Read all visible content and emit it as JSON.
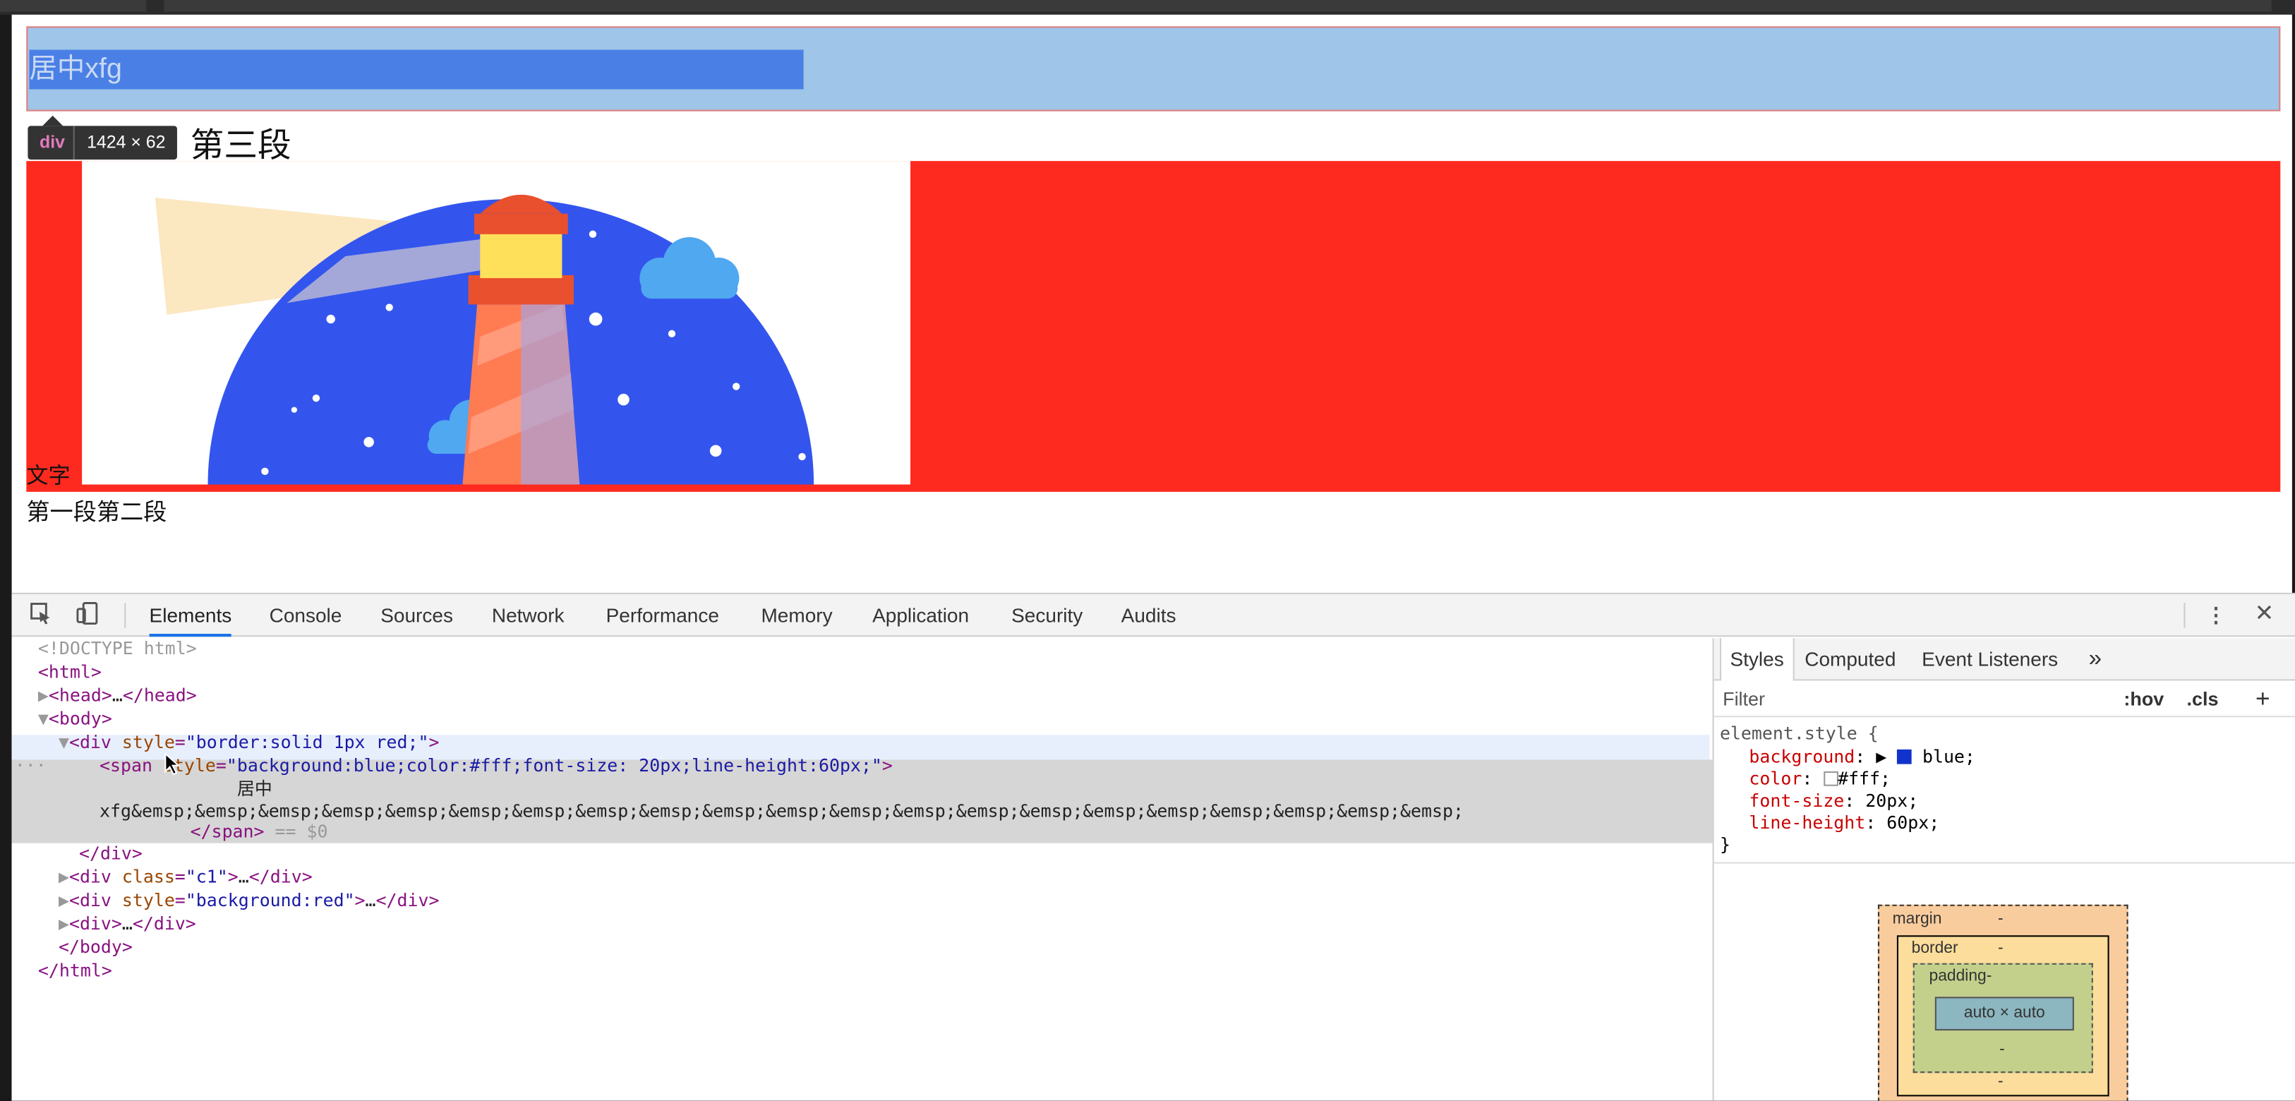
{
  "viewport": {
    "span_text": "居中xfg",
    "tooltip_tag": "div",
    "tooltip_dim": "1424 × 62",
    "para3": "第三段",
    "wenzi": "文字",
    "para12": "第一段第二段"
  },
  "colors": {
    "span_bg": "#4a80e6",
    "div_bg": "#9fc5e8",
    "red": "#ff2a1f",
    "lighthouse_sky": "#3355ee"
  },
  "devtools": {
    "tabs": [
      "Elements",
      "Console",
      "Sources",
      "Network",
      "Performance",
      "Memory",
      "Application",
      "Security",
      "Audits"
    ],
    "active_tab": "Elements",
    "more_icon": "kebab-icon",
    "close_icon": "close-icon",
    "elements": {
      "doctype": "<!DOCTYPE html>",
      "html_open": "<html>",
      "head": "…",
      "div1_attr": "style",
      "div1_val": "\"border:solid 1px red;\"",
      "span_attr": "style",
      "span_val": "\"background:blue;color:#fff;font-size: 20px;line-height:60px;\"",
      "span_text1": "居中",
      "span_text2": "xfg&emsp;&emsp;&emsp;&emsp;&emsp;&emsp;&emsp;&emsp;&emsp;&emsp;&emsp;&emsp;&emsp;&emsp;&emsp;&emsp;&emsp;&emsp;&emsp;&emsp;&emsp;",
      "span_close_suffix": " == $0",
      "div_c1_attr": "class",
      "div_c1_val": "\"c1\"",
      "div_red_attr": "style",
      "div_red_val": "\"background:red\"",
      "ellipsis": "…",
      "gutter_dots": "···"
    },
    "sidebar": {
      "tabs": [
        "Styles",
        "Computed",
        "Event Listeners"
      ],
      "more": "»",
      "filter_placeholder": "Filter",
      "hov": ":hov",
      "cls": ".cls",
      "plus": "+",
      "selector": "element.style {",
      "close_brace": "}",
      "props": [
        {
          "name": "background",
          "value": "blue;",
          "swatch": "#1133cc"
        },
        {
          "name": "color",
          "value": "#fff;",
          "swatch": "#ffffff"
        },
        {
          "name": "font-size",
          "value": "20px;"
        },
        {
          "name": "line-height",
          "value": "60px;"
        }
      ],
      "box_model": {
        "margin_label": "margin",
        "border_label": "border",
        "padding_label": "padding-",
        "content": "auto × auto",
        "dash": "-"
      }
    }
  }
}
